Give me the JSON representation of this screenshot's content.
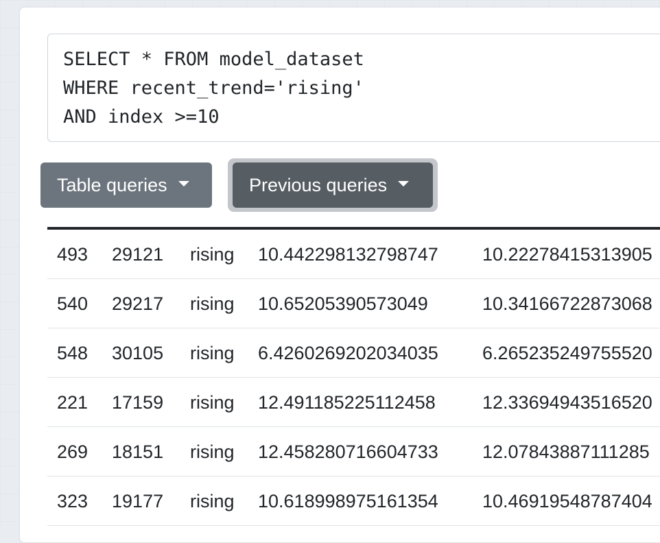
{
  "query": {
    "text": "SELECT * FROM model_dataset\nWHERE recent_trend='rising'\nAND index >=10"
  },
  "buttons": {
    "table_queries": "Table queries",
    "previous_queries": "Previous queries"
  },
  "icons": {
    "dropdown": "caret-down-icon"
  },
  "colors": {
    "table_queries_btn": "#6c757d",
    "previous_queries_btn": "#565e64",
    "focus_ring": "#c3c6ca",
    "table_header_rule": "#212529"
  },
  "results": {
    "rows": [
      [
        "493",
        "29121",
        "rising",
        "10.442298132798747",
        "10.22278415313905"
      ],
      [
        "540",
        "29217",
        "rising",
        "10.65205390573049",
        "10.34166722873068"
      ],
      [
        "548",
        "30105",
        "rising",
        "6.4260269202034035",
        "6.265235249755520"
      ],
      [
        "221",
        "17159",
        "rising",
        "12.491185225112458",
        "12.33694943516520"
      ],
      [
        "269",
        "18151",
        "rising",
        "12.458280716604733",
        "12.07843887111285"
      ],
      [
        "323",
        "19177",
        "rising",
        "10.618998975161354",
        "10.46919548787404"
      ]
    ]
  }
}
